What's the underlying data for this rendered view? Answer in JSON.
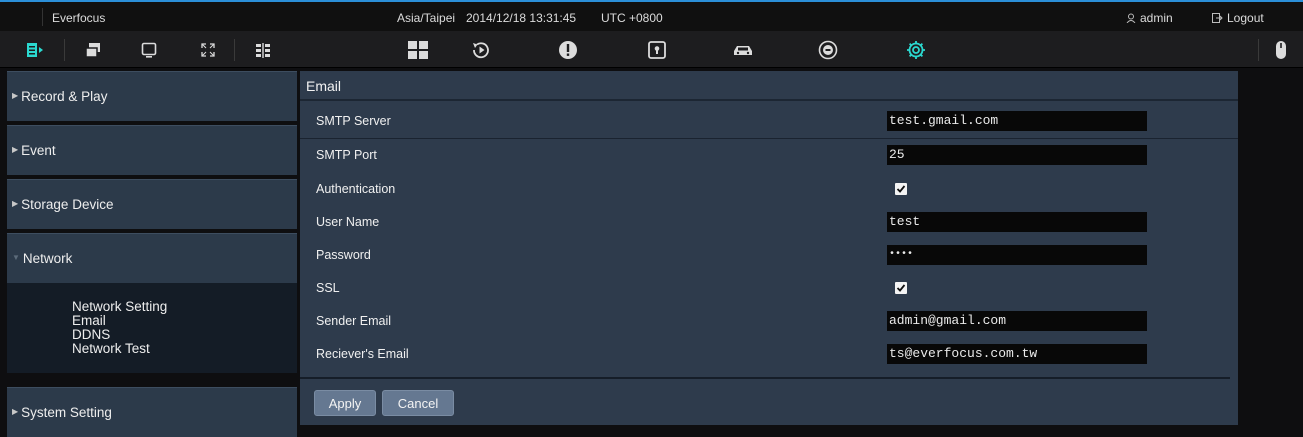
{
  "topbar": {
    "app_name": "Everfocus",
    "timezone": "Asia/Taipei",
    "datetime": "2014/12/18 13:31:45",
    "utc_offset": "UTC +0800",
    "user": "admin",
    "logout_label": "Logout"
  },
  "toolbar": {
    "left_icons": [
      "menu-icon",
      "window-overlap-icon",
      "monitor-icon",
      "fullscreen-icon",
      "split-view-icon"
    ],
    "center_icons": [
      "quad-view-icon",
      "playback-icon",
      "alert-icon",
      "lock-icon",
      "car-icon",
      "disc-icon",
      "settings-icon"
    ],
    "active_color": "#2bd9d0",
    "icon_color": "#dcdcdc"
  },
  "sidebar": {
    "items": [
      {
        "label": "Record & Play"
      },
      {
        "label": "Event"
      },
      {
        "label": "Storage Device"
      },
      {
        "label": "Network"
      },
      {
        "label": "System Setting"
      }
    ],
    "network_submenu": [
      "Network Setting",
      "Email",
      "DDNS",
      "Network Test"
    ]
  },
  "email": {
    "title": "Email",
    "smtp_server_label": "SMTP Server",
    "smtp_server_value": "test.gmail.com",
    "smtp_port_label": "SMTP Port",
    "smtp_port_value": "25",
    "auth_label": "Authentication",
    "auth_checked": true,
    "username_label": "User Name",
    "username_value": "test",
    "password_label": "Password",
    "password_value": "••••",
    "ssl_label": "SSL",
    "ssl_checked": true,
    "sender_label": "Sender Email",
    "sender_value": "admin@gmail.com",
    "receiver_label": "Reciever's Email",
    "receiver_value": "ts@everfocus.com.tw",
    "apply_label": "Apply",
    "cancel_label": "Cancel"
  },
  "colors": {
    "accent_blue": "#2b8fd8",
    "panel_bg": "#2e3b4c",
    "button_bg": "#657891"
  }
}
